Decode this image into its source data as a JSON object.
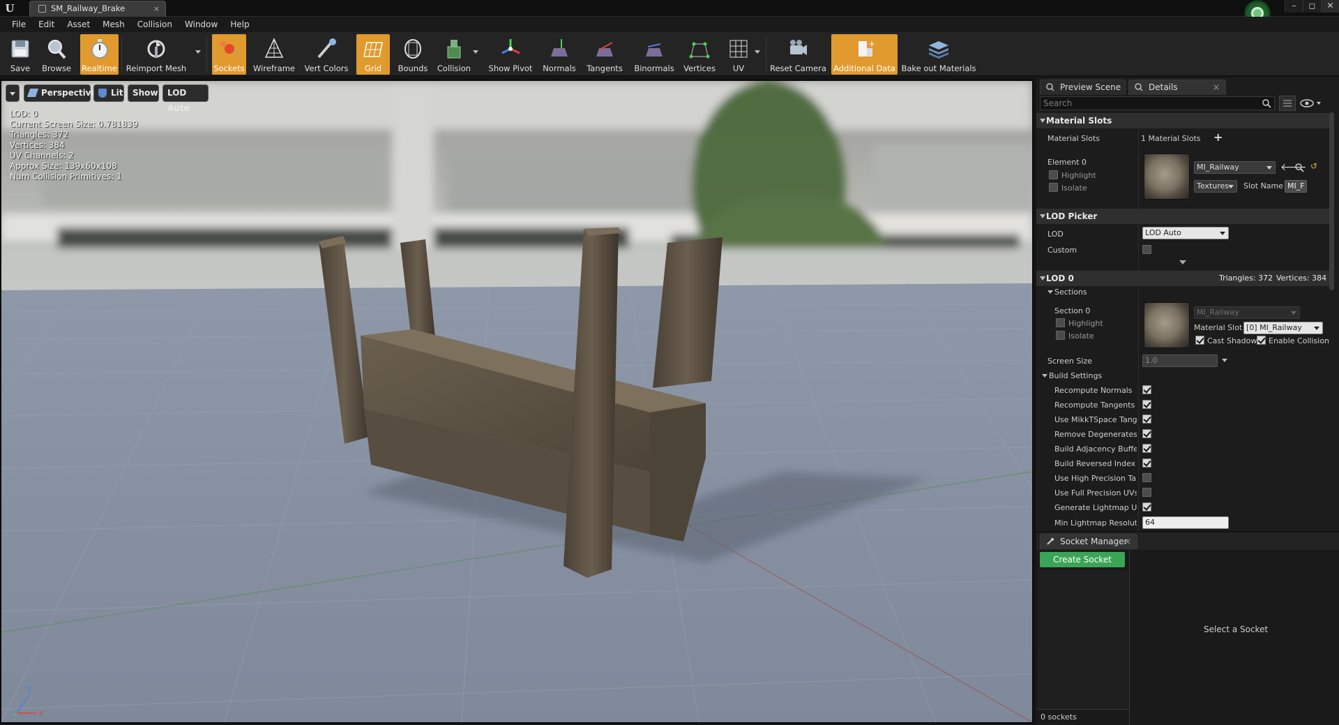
{
  "title_bar": {
    "tab_title": "SM_Railway_Brake",
    "tab_close": "×",
    "min": "–",
    "max": "◻",
    "close": "✕",
    "logo": "U"
  },
  "menu": [
    "File",
    "Edit",
    "Asset",
    "Mesh",
    "Collision",
    "Window",
    "Help"
  ],
  "toolbar": [
    {
      "label": "Save",
      "icon": "save-icon",
      "active": false
    },
    {
      "label": "Browse",
      "icon": "browse-icon",
      "active": false
    },
    {
      "label": "Realtime",
      "icon": "realtime-icon",
      "active": true
    },
    {
      "label": "Reimport Mesh",
      "icon": "reimport-icon",
      "active": false
    },
    {
      "label": "Sockets",
      "icon": "sockets-icon",
      "active": true
    },
    {
      "label": "Wireframe",
      "icon": "wireframe-icon",
      "active": false
    },
    {
      "label": "Vert Colors",
      "icon": "vert-colors-icon",
      "active": false
    },
    {
      "label": "Grid",
      "icon": "grid-icon",
      "active": true
    },
    {
      "label": "Bounds",
      "icon": "bounds-icon",
      "active": false
    },
    {
      "label": "Collision",
      "icon": "collision-icon",
      "active": false
    },
    {
      "label": "Show Pivot",
      "icon": "pivot-icon",
      "active": false
    },
    {
      "label": "Normals",
      "icon": "normals-icon",
      "active": false
    },
    {
      "label": "Tangents",
      "icon": "tangents-icon",
      "active": false
    },
    {
      "label": "Binormals",
      "icon": "binormals-icon",
      "active": false
    },
    {
      "label": "Vertices",
      "icon": "vertices-icon",
      "active": false
    },
    {
      "label": "UV",
      "icon": "uv-icon",
      "active": false
    },
    {
      "label": "Reset Camera",
      "icon": "reset-camera-icon",
      "active": false
    },
    {
      "label": "Additional Data",
      "icon": "additional-data-icon",
      "active": true
    },
    {
      "label": "Bake out Materials",
      "icon": "bake-materials-icon",
      "active": false
    }
  ],
  "viewport": {
    "buttons": {
      "perspective": "Perspective",
      "lit": "Lit",
      "show": "Show",
      "lod": "LOD Auto"
    },
    "stats": [
      "LOD:  0",
      "Current Screen Size:  0.781839",
      "Triangles:  372",
      "Vertices:  384",
      "UV Channels:  2",
      "Approx Size: 139x60x108",
      "Num Collision Primitives:  1"
    ],
    "axis": {
      "z": "Z",
      "x": "X"
    }
  },
  "details": {
    "tabs": {
      "preview": "Preview Scene Sett",
      "details": "Details"
    },
    "search_placeholder": "Search",
    "material_slots": {
      "header": "Material Slots",
      "label": "Material Slots",
      "count": "1 Material Slots",
      "element": "Element 0",
      "highlight": "Highlight",
      "isolate": "Isolate",
      "material": "MI_Railway",
      "textures": "Textures",
      "slot_name_label": "Slot Name",
      "slot_name_value": "MI_F"
    },
    "lod_picker": {
      "header": "LOD Picker",
      "lod_label": "LOD",
      "lod_value": "LOD Auto",
      "custom_label": "Custom"
    },
    "lod0": {
      "header": "LOD 0",
      "triangles": "Triangles: 372",
      "vertices": "Vertices: 384",
      "sections_header": "Sections",
      "section": "Section 0",
      "highlight": "Highlight",
      "isolate": "Isolate",
      "material": "MI_Railway",
      "material_slot_label": "Material Slot",
      "material_slot_value": "[0] MI_Railway",
      "cast_shadow": "Cast Shadow",
      "enable_collision": "Enable Collision",
      "screen_size_label": "Screen Size",
      "screen_size_value": "1.0"
    },
    "build_settings": {
      "header": "Build Settings",
      "items": [
        {
          "label": "Recompute Normals",
          "checked": true
        },
        {
          "label": "Recompute Tangents",
          "checked": true
        },
        {
          "label": "Use MikkTSpace Tange",
          "checked": true
        },
        {
          "label": "Remove Degenerates",
          "checked": true
        },
        {
          "label": "Build Adjacency Buffer",
          "checked": true
        },
        {
          "label": "Build Reversed Index B",
          "checked": true
        },
        {
          "label": "Use High Precision Tan",
          "checked": false
        },
        {
          "label": "Use Full Precision UVs",
          "checked": false
        },
        {
          "label": "Generate Lightmap UVs",
          "checked": true
        }
      ],
      "min_lightmap_label": "Min Lightmap Resolutic",
      "min_lightmap_value": "64"
    }
  },
  "socket_manager": {
    "tab": "Socket Manager",
    "create": "Create Socket",
    "select": "Select a Socket",
    "count": "0 sockets"
  }
}
